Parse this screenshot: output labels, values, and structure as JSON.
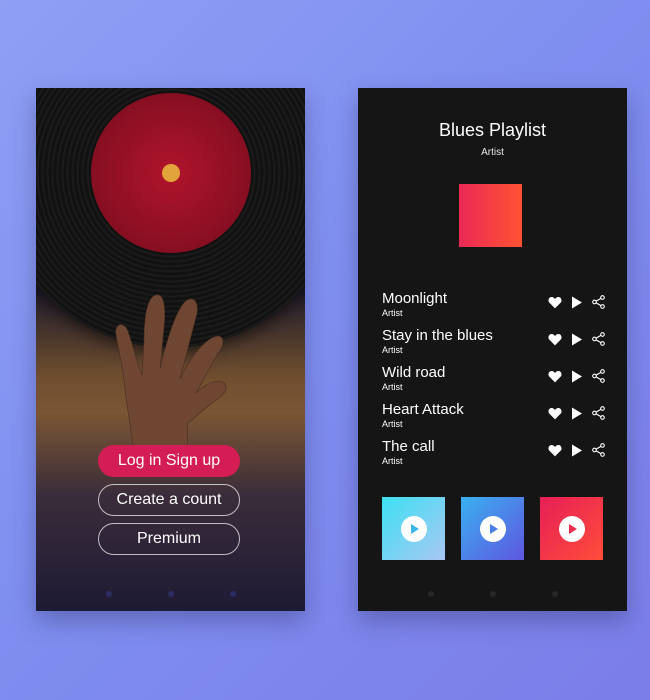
{
  "login_screen": {
    "buttons": {
      "login": "Log in Sign up",
      "create": "Create a count",
      "premium": "Premium"
    }
  },
  "playlist_screen": {
    "title": "Blues Playlist",
    "subtitle": "Artist",
    "tracks": [
      {
        "title": "Moonlight",
        "artist": "Artist"
      },
      {
        "title": "Stay in the blues",
        "artist": "Artist"
      },
      {
        "title": "Wild road",
        "artist": "Artist"
      },
      {
        "title": "Heart Attack",
        "artist": "Artist"
      },
      {
        "title": "The call",
        "artist": "Artist"
      }
    ],
    "track_icons": [
      "heart-icon",
      "play-icon",
      "share-icon"
    ],
    "tiles": [
      "play-circle-icon",
      "play-circle-icon",
      "play-circle-icon"
    ]
  },
  "colors": {
    "background": "#8595f2",
    "accent_pink": "#d31d54",
    "cover_gradient": [
      "#ea2955",
      "#ff5233"
    ],
    "vinyl_label": "#b0142c"
  }
}
